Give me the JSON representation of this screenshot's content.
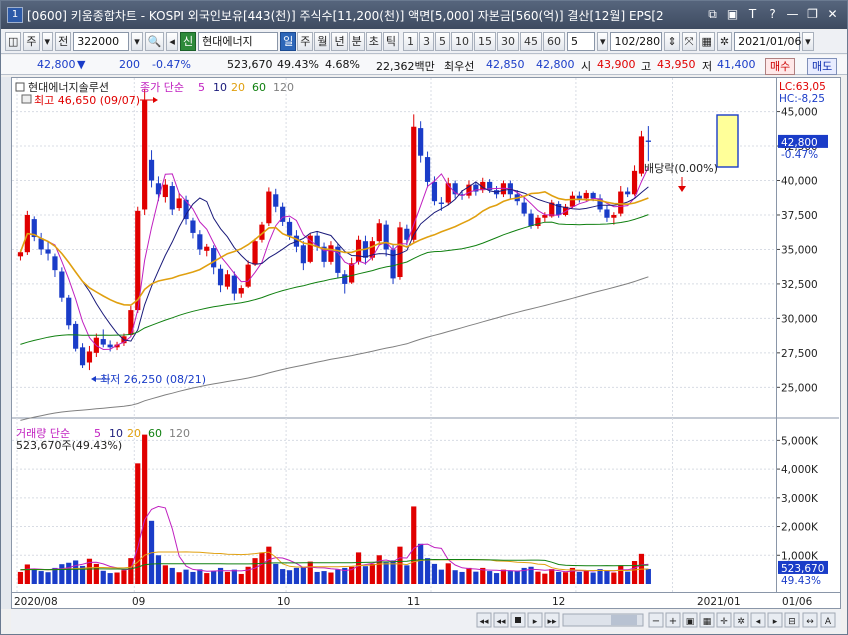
{
  "window": {
    "number": "1",
    "title": "[0600] 키움종합차트 - KOSPI 외국인보유[443(천)] 주식수[11,200(천)] 액면[5,000] 자본금[560(억)] 결산[12월] EPS[2"
  },
  "toolbar": {
    "market": "주",
    "prefix": "전",
    "code": "322000",
    "credit": "신",
    "stock_name": "현대에너지",
    "periods": [
      "일",
      "주",
      "월",
      "년",
      "분",
      "초",
      "틱"
    ],
    "selected_period": "일",
    "numbers": [
      "1",
      "3",
      "5",
      "10",
      "15",
      "30",
      "45",
      "60"
    ],
    "interval": "5",
    "count": "102/280",
    "date": "2021/01/06"
  },
  "info": {
    "price": "42,800",
    "change": "200",
    "change_pct": "-0.47%",
    "volume": "523,670",
    "vol_pct": "49.43%",
    "turnover": "4.68%",
    "amount": "22,362백만",
    "best_label": "최우선",
    "best_ask": "42,850",
    "best_bid": "42,800",
    "open_label": "시",
    "open": "43,900",
    "high_label": "고",
    "high": "43,950",
    "low_label": "저",
    "low": "41,400",
    "buy": "매수",
    "sell": "매도"
  },
  "chart_labels": {
    "stock": "현대에너지솔루션",
    "ma_title": "종가 단순",
    "ma_periods": [
      "5",
      "10",
      "20",
      "60",
      "120"
    ],
    "high_note": "최고 46,650 (09/07)",
    "low_note": "최저 26,250 (08/21)",
    "dividend_note": "배당락(0.00%)",
    "lc": "LC:63,05",
    "hc": "HC:-8,25",
    "last_price": "42,800",
    "last_pct": "-0.47%",
    "vol_title": "거래량 단순",
    "vol_current": "523,670주(49.43%)",
    "vol_last": "523,670",
    "vol_last_pct": "49.43%"
  },
  "colors": {
    "up": "#e00000",
    "down": "#1a3cc8",
    "ma5": "#c020c0",
    "ma10": "#1a1a7a",
    "ma20": "#e0a010",
    "ma60": "#108010",
    "ma120": "#808080"
  },
  "chart_data": {
    "type": "candlestick",
    "price_ticks": [
      25000,
      27500,
      30000,
      32500,
      35000,
      37500,
      40000,
      42500,
      45000
    ],
    "price_tick_labels": [
      "25,000",
      "27,500",
      "30,000",
      "32,500",
      "35,000",
      "37,500",
      "40,000",
      "42,500",
      "45,000"
    ],
    "price_range": [
      23500,
      47000
    ],
    "vol_ticks": [
      1000000,
      2000000,
      3000000,
      4000000,
      5000000
    ],
    "vol_tick_labels": [
      "1,000K",
      "2,000K",
      "3,000K",
      "4,000K",
      "5,000K"
    ],
    "vol_range": [
      0,
      5500000
    ],
    "x_labels": [
      "2020/08",
      "09",
      "10",
      "11",
      "12",
      "2021/01",
      "01/06"
    ],
    "candles": [
      [
        34500,
        34900,
        34200,
        34800
      ],
      [
        34800,
        37800,
        34600,
        37500
      ],
      [
        37200,
        37400,
        35600,
        35900
      ],
      [
        35800,
        36200,
        34600,
        35000
      ],
      [
        35000,
        35600,
        34200,
        34700
      ],
      [
        34500,
        34700,
        33000,
        33500
      ],
      [
        33400,
        33700,
        31200,
        31500
      ],
      [
        31500,
        31700,
        29200,
        29500
      ],
      [
        29600,
        29800,
        27600,
        27800
      ],
      [
        27900,
        28200,
        26400,
        26600
      ],
      [
        26800,
        28000,
        26250,
        27600
      ],
      [
        27500,
        28900,
        27200,
        28600
      ],
      [
        28500,
        29200,
        27900,
        28100
      ],
      [
        28100,
        28400,
        27600,
        27900
      ],
      [
        27900,
        28300,
        27700,
        28100
      ],
      [
        28200,
        28900,
        28000,
        28700
      ],
      [
        28800,
        30900,
        28700,
        30600
      ],
      [
        30600,
        38100,
        30400,
        37800
      ],
      [
        37900,
        46650,
        37500,
        45800
      ],
      [
        41500,
        42200,
        39500,
        40000
      ],
      [
        39800,
        40300,
        38500,
        39000
      ],
      [
        38800,
        40100,
        38400,
        39700
      ],
      [
        39600,
        39900,
        37500,
        37900
      ],
      [
        38000,
        39100,
        37800,
        38700
      ],
      [
        38600,
        38900,
        36800,
        37200
      ],
      [
        37100,
        37300,
        35800,
        36200
      ],
      [
        36100,
        36400,
        34600,
        35000
      ],
      [
        34900,
        35400,
        34500,
        35200
      ],
      [
        35100,
        35300,
        33200,
        33700
      ],
      [
        33600,
        33900,
        31900,
        32400
      ],
      [
        32300,
        33500,
        32100,
        33200
      ],
      [
        33100,
        33400,
        31300,
        31800
      ],
      [
        31800,
        32400,
        31500,
        32200
      ],
      [
        32300,
        34200,
        32200,
        33900
      ],
      [
        33900,
        35800,
        33800,
        35600
      ],
      [
        35700,
        37000,
        35500,
        36800
      ],
      [
        36900,
        39500,
        36700,
        39200
      ],
      [
        39000,
        39400,
        37700,
        38100
      ],
      [
        38100,
        38400,
        36700,
        37000
      ],
      [
        37000,
        37300,
        35700,
        36000
      ],
      [
        36000,
        36400,
        34800,
        35200
      ],
      [
        35300,
        35600,
        33500,
        34000
      ],
      [
        34100,
        36200,
        34000,
        36000
      ],
      [
        36000,
        36300,
        34900,
        35200
      ],
      [
        35200,
        35500,
        33700,
        34100
      ],
      [
        34100,
        35600,
        33900,
        35300
      ],
      [
        35200,
        35400,
        32900,
        33300
      ],
      [
        33200,
        33500,
        31800,
        32500
      ],
      [
        32600,
        34400,
        32500,
        34000
      ],
      [
        34100,
        36000,
        33900,
        35700
      ],
      [
        35600,
        36000,
        33900,
        34400
      ],
      [
        34400,
        35900,
        34200,
        35600
      ],
      [
        35600,
        37200,
        35300,
        36900
      ],
      [
        36800,
        37100,
        34500,
        35000
      ],
      [
        35000,
        35400,
        32500,
        32900
      ],
      [
        33000,
        37000,
        32800,
        36600
      ],
      [
        36500,
        36800,
        35300,
        35700
      ],
      [
        35700,
        44800,
        35500,
        43900
      ],
      [
        43800,
        44300,
        41300,
        41800
      ],
      [
        41700,
        42100,
        39500,
        39900
      ],
      [
        39900,
        40300,
        38200,
        38500
      ],
      [
        38400,
        38800,
        37800,
        38300
      ],
      [
        38400,
        40200,
        38200,
        39800
      ],
      [
        39800,
        40000,
        38700,
        39000
      ],
      [
        39000,
        39300,
        38600,
        38900
      ],
      [
        38900,
        40000,
        38700,
        39700
      ],
      [
        39700,
        39900,
        38900,
        39200
      ],
      [
        39300,
        40200,
        39100,
        39900
      ],
      [
        39900,
        40100,
        39100,
        39300
      ],
      [
        39300,
        39600,
        38700,
        39000
      ],
      [
        39000,
        40000,
        38800,
        39800
      ],
      [
        39800,
        40000,
        38700,
        39000
      ],
      [
        39000,
        39300,
        38200,
        38500
      ],
      [
        38400,
        38800,
        37400,
        37600
      ],
      [
        37600,
        37900,
        36500,
        36700
      ],
      [
        36700,
        37500,
        36500,
        37300
      ],
      [
        37300,
        37700,
        37000,
        37500
      ],
      [
        37400,
        38600,
        37300,
        38400
      ],
      [
        38300,
        38500,
        37300,
        37500
      ],
      [
        37500,
        38300,
        37400,
        38100
      ],
      [
        38100,
        39200,
        38000,
        38900
      ],
      [
        38900,
        39200,
        38400,
        38700
      ],
      [
        38700,
        39300,
        38500,
        39100
      ],
      [
        39100,
        39200,
        38500,
        38700
      ],
      [
        38700,
        39000,
        37700,
        37900
      ],
      [
        37900,
        38200,
        37000,
        37300
      ],
      [
        37300,
        37700,
        36800,
        37500
      ],
      [
        37600,
        39600,
        37400,
        39200
      ],
      [
        39200,
        39500,
        38800,
        39000
      ],
      [
        39000,
        41100,
        38900,
        40700
      ],
      [
        40500,
        43600,
        40300,
        43200
      ],
      [
        42900,
        43950,
        41400,
        42800
      ]
    ],
    "volumes": [
      [
        420000,
        1
      ],
      [
        680000,
        1
      ],
      [
        520000,
        0
      ],
      [
        450000,
        0
      ],
      [
        410000,
        0
      ],
      [
        560000,
        0
      ],
      [
        690000,
        0
      ],
      [
        740000,
        0
      ],
      [
        820000,
        0
      ],
      [
        630000,
        0
      ],
      [
        880000,
        1
      ],
      [
        700000,
        1
      ],
      [
        460000,
        0
      ],
      [
        380000,
        0
      ],
      [
        400000,
        1
      ],
      [
        480000,
        1
      ],
      [
        900000,
        1
      ],
      [
        4200000,
        1
      ],
      [
        5200000,
        1
      ],
      [
        2200000,
        0
      ],
      [
        1000000,
        0
      ],
      [
        650000,
        1
      ],
      [
        560000,
        0
      ],
      [
        410000,
        1
      ],
      [
        500000,
        0
      ],
      [
        420000,
        0
      ],
      [
        510000,
        0
      ],
      [
        380000,
        1
      ],
      [
        450000,
        0
      ],
      [
        560000,
        0
      ],
      [
        420000,
        1
      ],
      [
        500000,
        0
      ],
      [
        350000,
        1
      ],
      [
        600000,
        1
      ],
      [
        900000,
        1
      ],
      [
        1100000,
        1
      ],
      [
        1300000,
        1
      ],
      [
        700000,
        0
      ],
      [
        520000,
        0
      ],
      [
        480000,
        0
      ],
      [
        560000,
        0
      ],
      [
        600000,
        0
      ],
      [
        780000,
        1
      ],
      [
        420000,
        0
      ],
      [
        450000,
        0
      ],
      [
        400000,
        1
      ],
      [
        500000,
        0
      ],
      [
        560000,
        0
      ],
      [
        600000,
        1
      ],
      [
        1100000,
        1
      ],
      [
        620000,
        0
      ],
      [
        700000,
        1
      ],
      [
        1000000,
        1
      ],
      [
        750000,
        0
      ],
      [
        820000,
        0
      ],
      [
        1300000,
        1
      ],
      [
        650000,
        0
      ],
      [
        2700000,
        1
      ],
      [
        1400000,
        0
      ],
      [
        900000,
        0
      ],
      [
        700000,
        0
      ],
      [
        500000,
        0
      ],
      [
        720000,
        1
      ],
      [
        480000,
        0
      ],
      [
        420000,
        0
      ],
      [
        560000,
        1
      ],
      [
        430000,
        0
      ],
      [
        560000,
        1
      ],
      [
        450000,
        0
      ],
      [
        380000,
        0
      ],
      [
        500000,
        1
      ],
      [
        450000,
        0
      ],
      [
        460000,
        0
      ],
      [
        560000,
        0
      ],
      [
        600000,
        0
      ],
      [
        430000,
        1
      ],
      [
        360000,
        1
      ],
      [
        520000,
        1
      ],
      [
        420000,
        0
      ],
      [
        410000,
        1
      ],
      [
        560000,
        1
      ],
      [
        420000,
        0
      ],
      [
        480000,
        1
      ],
      [
        400000,
        0
      ],
      [
        520000,
        0
      ],
      [
        480000,
        0
      ],
      [
        400000,
        1
      ],
      [
        650000,
        1
      ],
      [
        430000,
        0
      ],
      [
        800000,
        1
      ],
      [
        1050000,
        1
      ],
      [
        523670,
        0
      ]
    ]
  }
}
